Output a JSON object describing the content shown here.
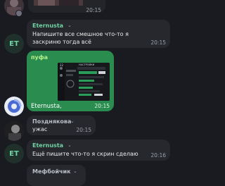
{
  "messages": [
    {
      "time": "20:15"
    },
    {
      "author": "Eternusta",
      "author_color": "#6fd3a1",
      "avatar_letters": "ET",
      "text_lines": [
        "Напишите все смешное что-то я",
        "заскриню тогда всё"
      ],
      "time": "20:15"
    },
    {
      "author": "пуфа",
      "author_color": "#b7f18a",
      "caption": "Eternusta,",
      "time": "20:15",
      "screenshot_labels": [
        "22",
        "НАСТРОЙКИ"
      ]
    },
    {
      "author": "Позднякова",
      "author_color": "#b9bec7",
      "text": "ужас",
      "time": "20:15"
    },
    {
      "author": "Eternusta",
      "author_color": "#6fd3a1",
      "avatar_letters": "ET",
      "text": "Ещё пишите что-то я скрин сделаю",
      "time": "20:16"
    },
    {
      "author": "Мефбойчик",
      "author_color": "#b9bec7"
    }
  ]
}
